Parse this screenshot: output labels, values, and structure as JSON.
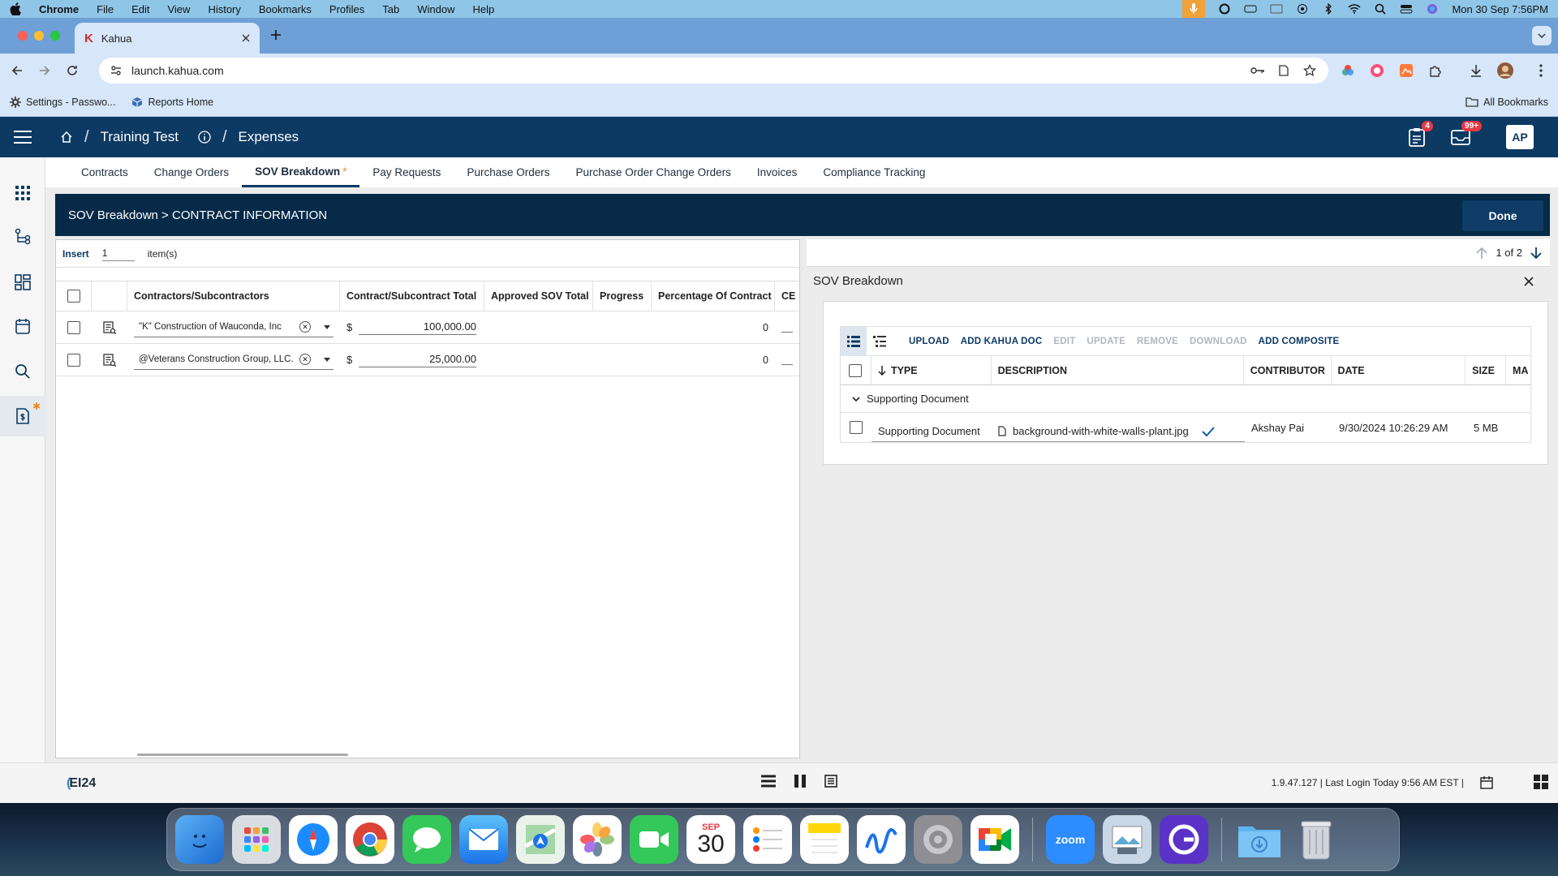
{
  "menubar": {
    "app": "Chrome",
    "items": [
      "File",
      "Edit",
      "View",
      "History",
      "Bookmarks",
      "Profiles",
      "Tab",
      "Window",
      "Help"
    ],
    "clock": "Mon 30 Sep  7:56PM"
  },
  "browser": {
    "tab_title": "Kahua",
    "tab_favicon": "K",
    "url": "launch.kahua.com",
    "bookmarks": [
      {
        "label": "Settings - Passwo..."
      },
      {
        "label": "Reports Home"
      }
    ],
    "all_bookmarks": "All Bookmarks"
  },
  "app": {
    "project": "Training Test",
    "module": "Expenses",
    "notifications_count": "4",
    "messages_count": "99+",
    "avatar_initials": "AP",
    "tabs": [
      {
        "label": "Contracts"
      },
      {
        "label": "Change Orders"
      },
      {
        "label": "SOV Breakdown",
        "star": "*"
      },
      {
        "label": "Pay Requests"
      },
      {
        "label": "Purchase Orders"
      },
      {
        "label": "Purchase Order Change Orders"
      },
      {
        "label": "Invoices"
      },
      {
        "label": "Compliance Tracking"
      }
    ],
    "panel_title": "SOV Breakdown > CONTRACT INFORMATION",
    "done_label": "Done",
    "insert": {
      "label": "Insert",
      "count": "1",
      "suffix": "item(s)"
    },
    "grid": {
      "columns": [
        "Contractors/Subcontractors",
        "Contract/Subcontract Total",
        "Approved SOV Total",
        "Progress",
        "Percentage Of Contract",
        "CE"
      ],
      "rows": [
        {
          "contractor": "\"K\" Construction of Wauconda, Inc",
          "currency": "$",
          "total": "100,000.00",
          "percentage": "0"
        },
        {
          "contractor": "@Veterans Construction Group, LLC.",
          "currency": "$",
          "total": "25,000.00",
          "percentage": "0"
        }
      ]
    },
    "pager": "1 of 2",
    "sov_title": "SOV Breakdown",
    "doc_toolbar": [
      {
        "label": "UPLOAD",
        "enabled": true
      },
      {
        "label": "ADD KAHUA DOC",
        "enabled": true
      },
      {
        "label": "EDIT",
        "enabled": false
      },
      {
        "label": "UPDATE",
        "enabled": false
      },
      {
        "label": "REMOVE",
        "enabled": false
      },
      {
        "label": "DOWNLOAD",
        "enabled": false
      },
      {
        "label": "ADD COMPOSITE",
        "enabled": true
      }
    ],
    "doc_columns": [
      "TYPE",
      "DESCRIPTION",
      "CONTRIBUTOR",
      "DATE",
      "SIZE",
      "MA"
    ],
    "doc_group": "Supporting Document",
    "doc_rows": [
      {
        "type": "Supporting Document",
        "description": "background-with-white-walls-plant.jpg",
        "contributor": "Akshay Pai",
        "date": "9/30/2024 10:26:29 AM",
        "size": "5 MB"
      }
    ],
    "footer_logo": "EI24",
    "footer_info": "1.9.47.127  |  Last Login Today 9:56 AM EST  |"
  },
  "dock": {
    "calendar_month": "SEP",
    "calendar_day": "30",
    "zoom_label": "zoom"
  },
  "colors": {
    "header": "#0d3a63",
    "panel": "#062a48",
    "accent": "#f08a24",
    "badge": "#e63946"
  }
}
